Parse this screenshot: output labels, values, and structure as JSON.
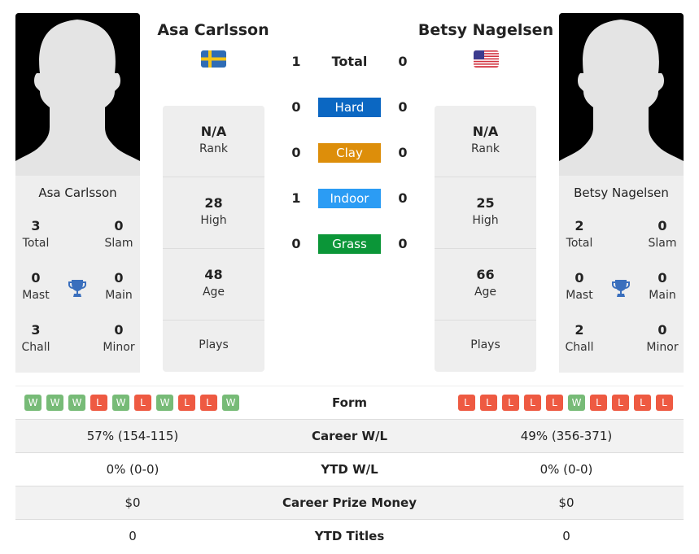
{
  "players": [
    {
      "name": "Asa Carlsson",
      "flag": "sweden-flag",
      "flag_colors": {
        "field": "#2f6cb5",
        "cross": "#f4c518"
      },
      "titles": {
        "total": "3",
        "slam": "0",
        "mast": "0",
        "main": "0",
        "chall": "3",
        "minor": "0"
      },
      "rank": "N/A",
      "high": "28",
      "age": "48",
      "plays": "",
      "form": [
        "W",
        "W",
        "W",
        "L",
        "W",
        "L",
        "W",
        "L",
        "L",
        "W"
      ],
      "career_wl": "57% (154-115)",
      "ytd_wl": "0% (0-0)",
      "prize_money": "$0",
      "ytd_titles": "0"
    },
    {
      "name": "Betsy Nagelsen",
      "flag": "usa-flag",
      "flag_colors": {
        "stripe_red": "#d2323f",
        "canton": "#3c3b8e"
      },
      "titles": {
        "total": "2",
        "slam": "0",
        "mast": "0",
        "main": "0",
        "chall": "2",
        "minor": "0"
      },
      "rank": "N/A",
      "high": "25",
      "age": "66",
      "plays": "",
      "form": [
        "L",
        "L",
        "L",
        "L",
        "L",
        "W",
        "L",
        "L",
        "L",
        "L"
      ],
      "career_wl": "49% (356-371)",
      "ytd_wl": "0% (0-0)",
      "prize_money": "$0",
      "ytd_titles": "0"
    }
  ],
  "labels": {
    "total": "Total",
    "slam": "Slam",
    "mast": "Mast",
    "main": "Main",
    "chall": "Chall",
    "minor": "Minor",
    "rank": "Rank",
    "high": "High",
    "age": "Age",
    "plays": "Plays",
    "form": "Form",
    "career_wl": "Career W/L",
    "ytd_wl": "YTD W/L",
    "prize_money": "Career Prize Money",
    "ytd_titles": "YTD Titles"
  },
  "h2h": {
    "total": {
      "label": "Total",
      "p1": "1",
      "p2": "0"
    },
    "surfaces": [
      {
        "label": "Hard",
        "p1": "0",
        "p2": "0",
        "color": "#0b67c2"
      },
      {
        "label": "Clay",
        "p1": "0",
        "p2": "0",
        "color": "#dd8e0a"
      },
      {
        "label": "Indoor",
        "p1": "1",
        "p2": "0",
        "color": "#2b9cf4"
      },
      {
        "label": "Grass",
        "p1": "0",
        "p2": "0",
        "color": "#0b9638"
      }
    ]
  },
  "colors": {
    "win": "#77bb77",
    "loss": "#ee5a42",
    "trophy": "#3a6fbd"
  }
}
